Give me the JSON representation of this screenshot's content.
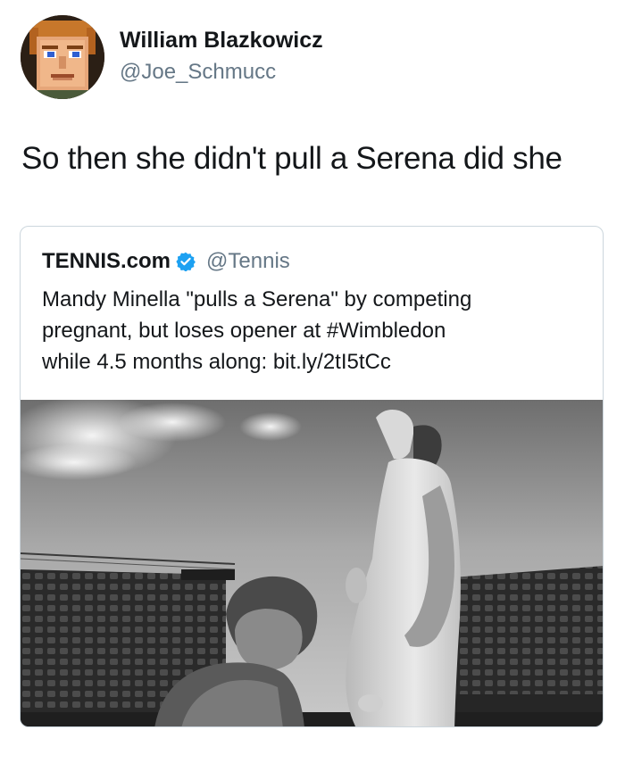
{
  "tweet": {
    "author": {
      "name": "William Blazkowicz",
      "handle": "@Joe_Schmucc",
      "avatar_icon": "pixel-face-avatar"
    },
    "text": "So then she didn't pull a Serena did she"
  },
  "quoted_tweet": {
    "author": {
      "name": "TENNIS.com",
      "handle": "@Tennis",
      "verified": true,
      "verified_icon": "verified-badge-icon"
    },
    "text_lines": [
      "Mandy Minella \"pulls a Serena\" by competing",
      "pregnant, but loses opener at #Wimbledon",
      "while 4.5 months along: bit.ly/2tI5tCc"
    ],
    "media": {
      "type": "photo",
      "style": "black-and-white"
    }
  },
  "colors": {
    "text_primary": "#14171a",
    "text_secondary": "#657786",
    "card_border": "#ccd6dd",
    "verified_blue": "#1da1f2"
  }
}
